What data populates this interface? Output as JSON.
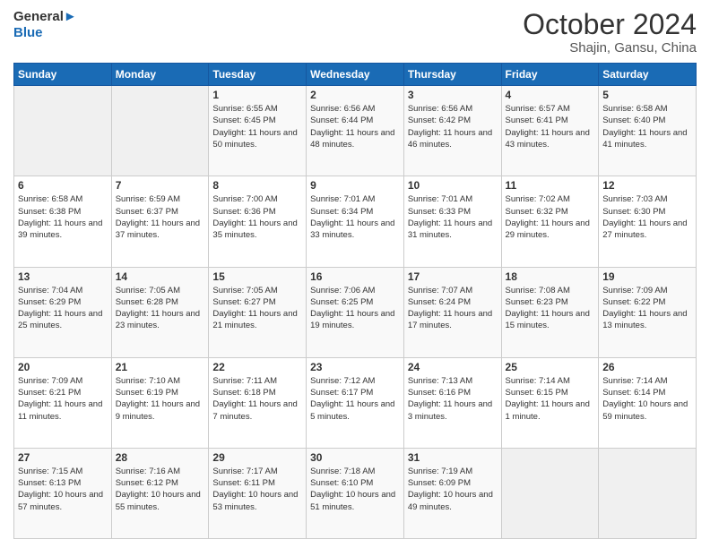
{
  "logo": {
    "line1": "General",
    "line2": "Blue"
  },
  "title": "October 2024",
  "subtitle": "Shajin, Gansu, China",
  "days_header": [
    "Sunday",
    "Monday",
    "Tuesday",
    "Wednesday",
    "Thursday",
    "Friday",
    "Saturday"
  ],
  "weeks": [
    [
      {
        "day": "",
        "info": ""
      },
      {
        "day": "",
        "info": ""
      },
      {
        "day": "1",
        "info": "Sunrise: 6:55 AM\nSunset: 6:45 PM\nDaylight: 11 hours and 50 minutes."
      },
      {
        "day": "2",
        "info": "Sunrise: 6:56 AM\nSunset: 6:44 PM\nDaylight: 11 hours and 48 minutes."
      },
      {
        "day": "3",
        "info": "Sunrise: 6:56 AM\nSunset: 6:42 PM\nDaylight: 11 hours and 46 minutes."
      },
      {
        "day": "4",
        "info": "Sunrise: 6:57 AM\nSunset: 6:41 PM\nDaylight: 11 hours and 43 minutes."
      },
      {
        "day": "5",
        "info": "Sunrise: 6:58 AM\nSunset: 6:40 PM\nDaylight: 11 hours and 41 minutes."
      }
    ],
    [
      {
        "day": "6",
        "info": "Sunrise: 6:58 AM\nSunset: 6:38 PM\nDaylight: 11 hours and 39 minutes."
      },
      {
        "day": "7",
        "info": "Sunrise: 6:59 AM\nSunset: 6:37 PM\nDaylight: 11 hours and 37 minutes."
      },
      {
        "day": "8",
        "info": "Sunrise: 7:00 AM\nSunset: 6:36 PM\nDaylight: 11 hours and 35 minutes."
      },
      {
        "day": "9",
        "info": "Sunrise: 7:01 AM\nSunset: 6:34 PM\nDaylight: 11 hours and 33 minutes."
      },
      {
        "day": "10",
        "info": "Sunrise: 7:01 AM\nSunset: 6:33 PM\nDaylight: 11 hours and 31 minutes."
      },
      {
        "day": "11",
        "info": "Sunrise: 7:02 AM\nSunset: 6:32 PM\nDaylight: 11 hours and 29 minutes."
      },
      {
        "day": "12",
        "info": "Sunrise: 7:03 AM\nSunset: 6:30 PM\nDaylight: 11 hours and 27 minutes."
      }
    ],
    [
      {
        "day": "13",
        "info": "Sunrise: 7:04 AM\nSunset: 6:29 PM\nDaylight: 11 hours and 25 minutes."
      },
      {
        "day": "14",
        "info": "Sunrise: 7:05 AM\nSunset: 6:28 PM\nDaylight: 11 hours and 23 minutes."
      },
      {
        "day": "15",
        "info": "Sunrise: 7:05 AM\nSunset: 6:27 PM\nDaylight: 11 hours and 21 minutes."
      },
      {
        "day": "16",
        "info": "Sunrise: 7:06 AM\nSunset: 6:25 PM\nDaylight: 11 hours and 19 minutes."
      },
      {
        "day": "17",
        "info": "Sunrise: 7:07 AM\nSunset: 6:24 PM\nDaylight: 11 hours and 17 minutes."
      },
      {
        "day": "18",
        "info": "Sunrise: 7:08 AM\nSunset: 6:23 PM\nDaylight: 11 hours and 15 minutes."
      },
      {
        "day": "19",
        "info": "Sunrise: 7:09 AM\nSunset: 6:22 PM\nDaylight: 11 hours and 13 minutes."
      }
    ],
    [
      {
        "day": "20",
        "info": "Sunrise: 7:09 AM\nSunset: 6:21 PM\nDaylight: 11 hours and 11 minutes."
      },
      {
        "day": "21",
        "info": "Sunrise: 7:10 AM\nSunset: 6:19 PM\nDaylight: 11 hours and 9 minutes."
      },
      {
        "day": "22",
        "info": "Sunrise: 7:11 AM\nSunset: 6:18 PM\nDaylight: 11 hours and 7 minutes."
      },
      {
        "day": "23",
        "info": "Sunrise: 7:12 AM\nSunset: 6:17 PM\nDaylight: 11 hours and 5 minutes."
      },
      {
        "day": "24",
        "info": "Sunrise: 7:13 AM\nSunset: 6:16 PM\nDaylight: 11 hours and 3 minutes."
      },
      {
        "day": "25",
        "info": "Sunrise: 7:14 AM\nSunset: 6:15 PM\nDaylight: 11 hours and 1 minute."
      },
      {
        "day": "26",
        "info": "Sunrise: 7:14 AM\nSunset: 6:14 PM\nDaylight: 10 hours and 59 minutes."
      }
    ],
    [
      {
        "day": "27",
        "info": "Sunrise: 7:15 AM\nSunset: 6:13 PM\nDaylight: 10 hours and 57 minutes."
      },
      {
        "day": "28",
        "info": "Sunrise: 7:16 AM\nSunset: 6:12 PM\nDaylight: 10 hours and 55 minutes."
      },
      {
        "day": "29",
        "info": "Sunrise: 7:17 AM\nSunset: 6:11 PM\nDaylight: 10 hours and 53 minutes."
      },
      {
        "day": "30",
        "info": "Sunrise: 7:18 AM\nSunset: 6:10 PM\nDaylight: 10 hours and 51 minutes."
      },
      {
        "day": "31",
        "info": "Sunrise: 7:19 AM\nSunset: 6:09 PM\nDaylight: 10 hours and 49 minutes."
      },
      {
        "day": "",
        "info": ""
      },
      {
        "day": "",
        "info": ""
      }
    ]
  ]
}
